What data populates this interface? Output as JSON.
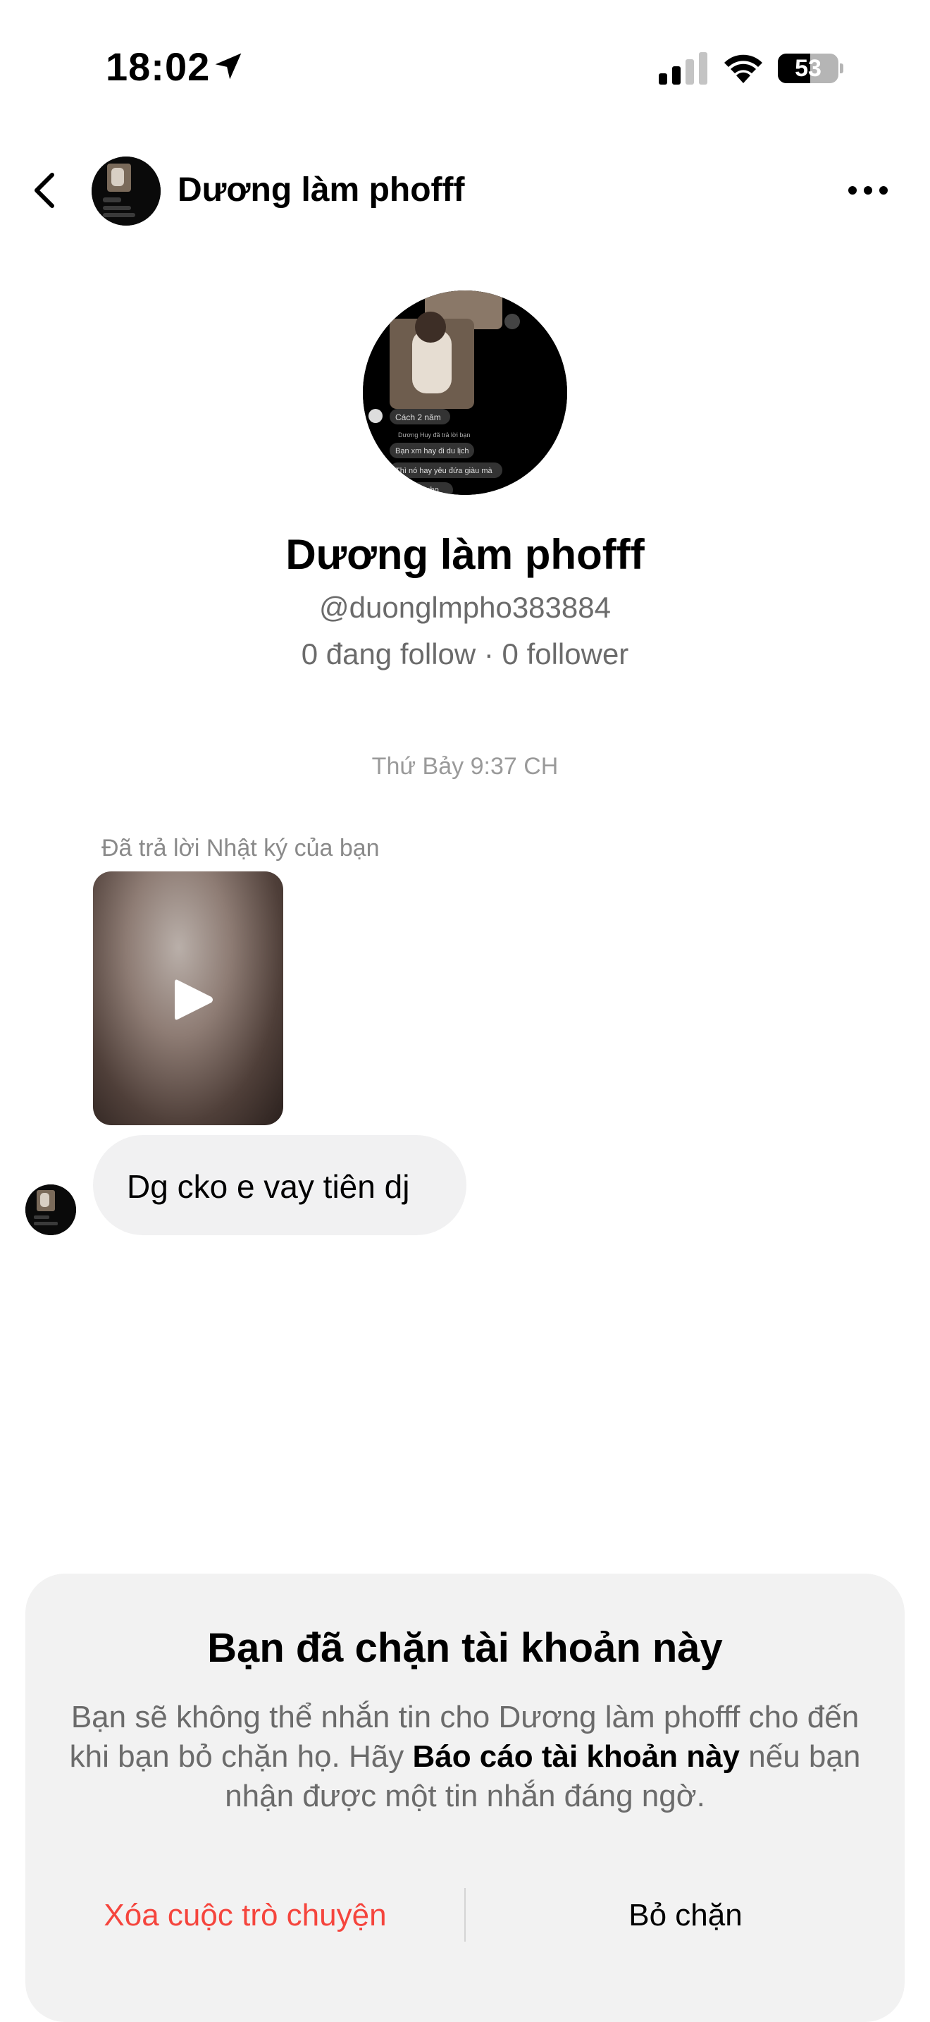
{
  "status_bar": {
    "time": "18:02",
    "battery_text": "53",
    "battery_level": 0.53,
    "icons": [
      "location-arrow-icon",
      "cellular-signal-icon",
      "wifi-icon",
      "battery-icon"
    ]
  },
  "header": {
    "name": "Dương làm phofff",
    "icons": [
      "back-chevron-icon",
      "more-dots-icon"
    ]
  },
  "profile": {
    "name": "Dương làm phofff",
    "handle": "@duonglmpho383884",
    "stats": "0 đang follow · 0 follower"
  },
  "conversation": {
    "timestamp": "Thứ Bảy 9:37 CH",
    "reply_label": "Đã trả lời Nhật ký của bạn",
    "message_text": "Dg cko e vay tiên dj"
  },
  "blocked_card": {
    "title": "Bạn đã chặn tài khoản này",
    "desc_part1": "Bạn sẽ không thể nhắn tin cho Dương làm phofff cho đến khi bạn bỏ chặn họ. Hãy ",
    "desc_bold": "Báo cáo tài khoản này",
    "desc_part2": " nếu bạn nhận được một tin nhắn đáng ngờ.",
    "delete_label": "Xóa cuộc trò chuyện",
    "unblock_label": "Bỏ chặn",
    "delete_color": "#f5453d"
  },
  "avatar_overlay": {
    "time_chip": "Cách 2 năm",
    "reply_line": "Dương Huy đã trả lời bạn",
    "msg1": "Bạn xm hay đi du lịch",
    "msg2": "Thì nó hay yêu đứa giàu mà",
    "msg3": "cho"
  }
}
